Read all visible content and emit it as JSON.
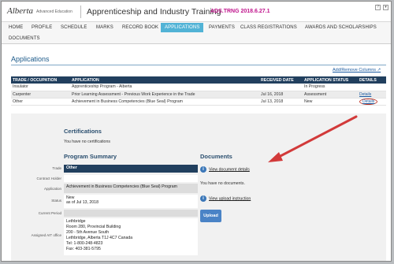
{
  "header": {
    "logo_text": "Alberta",
    "logo_sub": "Advanced Education",
    "app_title": "Apprenticeship and Industry Training",
    "env_badge": "ADS.TRNG 2018.6.27.1"
  },
  "nav": {
    "items": [
      "HOME",
      "PROFILE",
      "SCHEDULE",
      "MARKS",
      "RECORD BOOK",
      "APPLICATIONS",
      "PAYMENTS",
      "CLASS REGISTRATIONS",
      "AWARDS AND SCHOLARSHIPS",
      "DOCUMENTS"
    ],
    "active": "APPLICATIONS"
  },
  "applications": {
    "title": "Applications",
    "add_remove_columns": "Add/Remove Columns",
    "columns": [
      "TRADE / OCCUPATION",
      "APPLICATION",
      "RECEIVED DATE",
      "APPLICATION STATUS",
      "DETAILS"
    ],
    "rows": [
      {
        "trade": "Insulator",
        "application": "Apprenticeship Program - Alberta",
        "received": "",
        "status": "In Progress",
        "details": ""
      },
      {
        "trade": "Carpenter",
        "application": "Prior Learning Assessment - Previous Work Experience in the Trade",
        "received": "Jul 16, 2018",
        "status": "Assessment",
        "details": "Details"
      },
      {
        "trade": "Other",
        "application": "Achievement in Business Competencies (Blue Seal) Program",
        "received": "Jul 13, 2018",
        "status": "New",
        "details": "Details"
      }
    ]
  },
  "certifications": {
    "title": "Certifications",
    "text": "You have no certifications"
  },
  "program_summary": {
    "title": "Program Summary",
    "trade_label": "Trade",
    "trade_value": "Other",
    "contract_label": "Contract Holder",
    "application_label": "Application",
    "application_value": "Achievement in Business Competencies (Blue Seal) Program",
    "status_label": "Status",
    "status_value": "New",
    "status_date": "as of Jul 13, 2018",
    "period_label": "Current Period",
    "office_label": "Assigned AIT office",
    "office_lines": [
      "Lethbridge",
      "Room 280, Provincial Building",
      "200 - 5th Avenue South",
      "Lethbridge, Alberta T1J 4C7 Canada",
      "Tel: 1-800-248-4823",
      "Fax: 403-381-5795"
    ]
  },
  "documents": {
    "title": "Documents",
    "view_details": "View document details",
    "no_docs": "You have no documents.",
    "view_upload": "View upload instruction",
    "upload_button": "Upload"
  },
  "colors": {
    "header_dark": "#213f5e",
    "active_tab": "#52b3d6",
    "env_badge": "#c0148c",
    "annotation_red": "#d23a3a",
    "link": "#1a5aa0"
  }
}
